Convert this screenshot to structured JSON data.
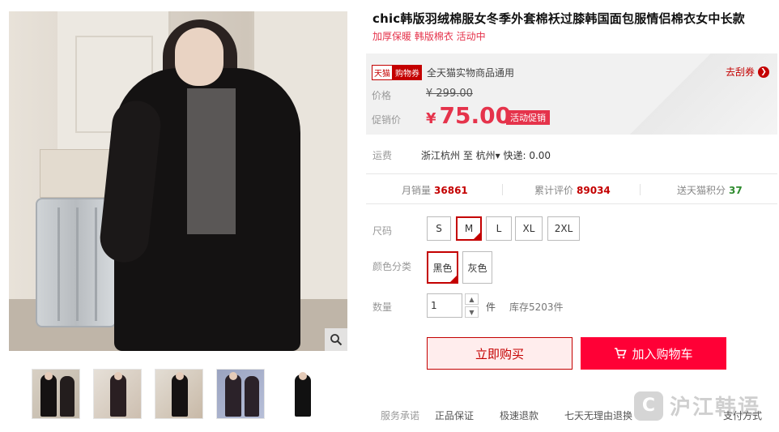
{
  "product": {
    "title": "chic韩版羽绒棉服女冬季外套棉袄过膝韩国面包服情侣棉衣女中长款",
    "subtitle": "加厚保暖 韩版棉衣 活动中"
  },
  "coupon": {
    "badge_tmall": "天猫",
    "badge_voucher": "购物券",
    "text": "全天猫实物商品通用",
    "link_label": "去刮券",
    "link_arrow": "❯"
  },
  "price": {
    "label": "价格",
    "old_value": "¥ 299.00",
    "sale_label": "促销价",
    "currency": "¥",
    "sale_value": "75.00",
    "promo_tag": "活动促销"
  },
  "shipping": {
    "label": "运费",
    "value": "浙江杭州  至 杭州▾  快递: 0.00"
  },
  "stats": {
    "monthly_sales_label": "月销量",
    "monthly_sales": "36861",
    "reviews_label": "累计评价",
    "reviews": "89034",
    "points_label": "送天猫积分",
    "points": "37"
  },
  "options": {
    "size_label": "尺码",
    "sizes": [
      "S",
      "M",
      "L",
      "XL",
      "2XL"
    ],
    "selected_size": "M",
    "color_label": "颜色分类",
    "colors": [
      "黑色",
      "灰色"
    ],
    "selected_color": "黑色",
    "qty_label": "数量",
    "qty_value": "1",
    "qty_unit": "件",
    "stock": "库存5203件"
  },
  "actions": {
    "buy_now": "立即购买",
    "add_cart": "加入购物车"
  },
  "service": {
    "label": "服务承诺",
    "items": [
      "正品保证",
      "极速退款",
      "七天无理由退换"
    ],
    "payment": "支付方式"
  },
  "watermark": {
    "logo": "C",
    "text": "沪江韩语"
  },
  "colors": {
    "accent": "#c40000",
    "cart": "#ff0036",
    "promo": "#e5334b"
  }
}
